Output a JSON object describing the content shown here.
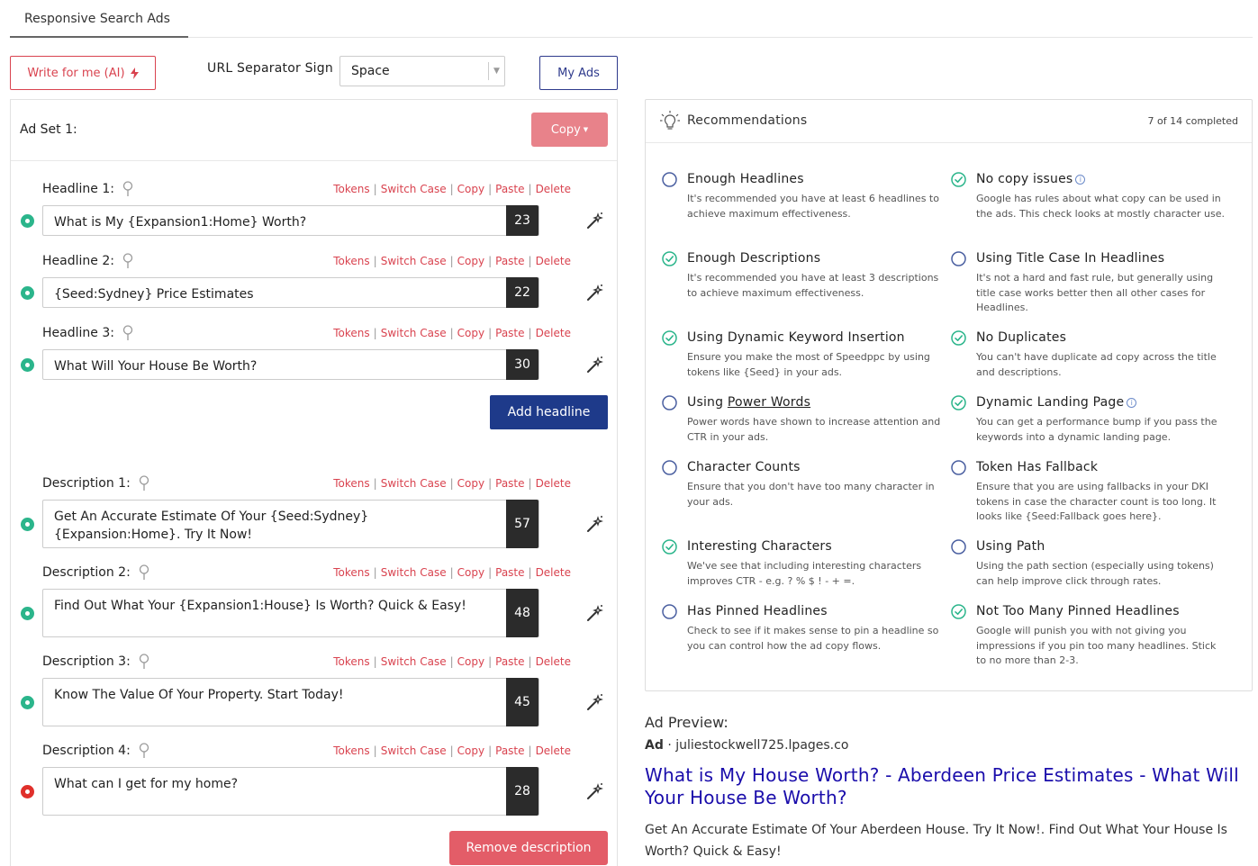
{
  "tab": {
    "label": "Responsive Search Ads"
  },
  "toolbar": {
    "write_label": "Write for me (AI)",
    "sep_label": "URL Separator Sign",
    "sep_value": "Space",
    "myads_label": "My Ads"
  },
  "adset": {
    "title": "Ad Set 1:",
    "copy_label": "Copy"
  },
  "actions": {
    "tokens": "Tokens",
    "switch_case": "Switch Case",
    "copy": "Copy",
    "paste": "Paste",
    "delete": "Delete",
    "sep": "|"
  },
  "headlines": [
    {
      "label": "Headline 1:",
      "text": "What is My {Expansion1:Home} Worth?",
      "count": "23",
      "status": "green"
    },
    {
      "label": "Headline 2:",
      "text": "{Seed:Sydney} Price Estimates",
      "count": "22",
      "status": "green"
    },
    {
      "label": "Headline 3:",
      "text": "What Will Your House Be Worth?",
      "count": "30",
      "status": "green"
    }
  ],
  "add_headline_label": "Add headline",
  "descriptions": [
    {
      "label": "Description 1:",
      "text": "Get An Accurate Estimate Of Your {Seed:Sydney} {Expansion:Home}. Try It Now!",
      "count": "57",
      "status": "green"
    },
    {
      "label": "Description 2:",
      "text": "Find Out What Your {Expansion1:House} Is Worth? Quick & Easy!",
      "count": "48",
      "status": "green"
    },
    {
      "label": "Description 3:",
      "text": "Know The Value Of Your Property. Start Today!",
      "count": "45",
      "status": "green"
    },
    {
      "label": "Description 4:",
      "text": "What can I get for my home?",
      "count": "28",
      "status": "red"
    }
  ],
  "remove_description_label": "Remove description",
  "recommendations": {
    "title": "Recommendations",
    "completed": "7 of 14 completed",
    "items": [
      {
        "title": "Enough Headlines",
        "desc": "It's recommended you have at least 6 headlines to achieve maximum effectiveness.",
        "done": false
      },
      {
        "title": "No copy issues",
        "desc": "Google has rules about what copy can be used in the ads. This check looks at mostly character use.",
        "done": true
      },
      {
        "title": "Enough Descriptions",
        "desc": "It's recommended you have at least 3 descriptions to achieve maximum effectiveness.",
        "done": true
      },
      {
        "title": "Using Title Case In Headlines",
        "desc": "It's not a hard and fast rule, but generally using title case works better then all other cases for Headlines.",
        "done": false
      },
      {
        "title": "Using Dynamic Keyword Insertion",
        "desc": "Ensure you make the most of Speedppc by using tokens like {Seed} in your ads.",
        "done": true
      },
      {
        "title": "No Duplicates",
        "desc": "You can't have duplicate ad copy across the title and descriptions.",
        "done": true
      },
      {
        "title_prefix": "Using ",
        "title_link": "Power Words",
        "desc": "Power words have shown to increase attention and CTR in your ads.",
        "done": false
      },
      {
        "title": "Dynamic Landing Page",
        "desc": "You can get a performance bump if you pass the keywords into a dynamic landing page.",
        "done": true
      },
      {
        "title": "Character Counts",
        "desc": "Ensure that you don't have too many character in your ads.",
        "done": false
      },
      {
        "title": "Token Has Fallback",
        "desc": "Ensure that you are using fallbacks in your DKI tokens in case the character count is too long. It looks like {Seed:Fallback goes here}.",
        "done": false
      },
      {
        "title": "Interesting Characters",
        "desc": "We've see that including interesting characters improves CTR - e.g. ? % $ ! - + =.",
        "done": true
      },
      {
        "title": "Using Path",
        "desc": "Using the path section (especially using tokens) can help improve click through rates.",
        "done": false
      },
      {
        "title": "Has Pinned Headlines",
        "desc": "Check to see if it makes sense to pin a headline so you can control how the ad copy flows.",
        "done": false
      },
      {
        "title": "Not Too Many Pinned Headlines",
        "desc": "Google will punish you with not giving you impressions if you pin too many headlines. Stick to no more than 2-3.",
        "done": true
      }
    ]
  },
  "preview": {
    "label": "Ad Preview:",
    "ad_tag": "Ad",
    "url": "· juliestockwell725.lpages.co",
    "headline": "What is My House Worth? - Aberdeen Price Estimates - What Will Your House Be Worth?",
    "desc": "Get An Accurate Estimate Of Your Aberdeen House. Try It Now!. Find Out What Your House Is Worth? Quick & Easy!"
  },
  "colors": {
    "accent_red": "#d9434f",
    "navy": "#1e3a8a",
    "green": "#2bb58b",
    "link": "#1a0dab"
  }
}
